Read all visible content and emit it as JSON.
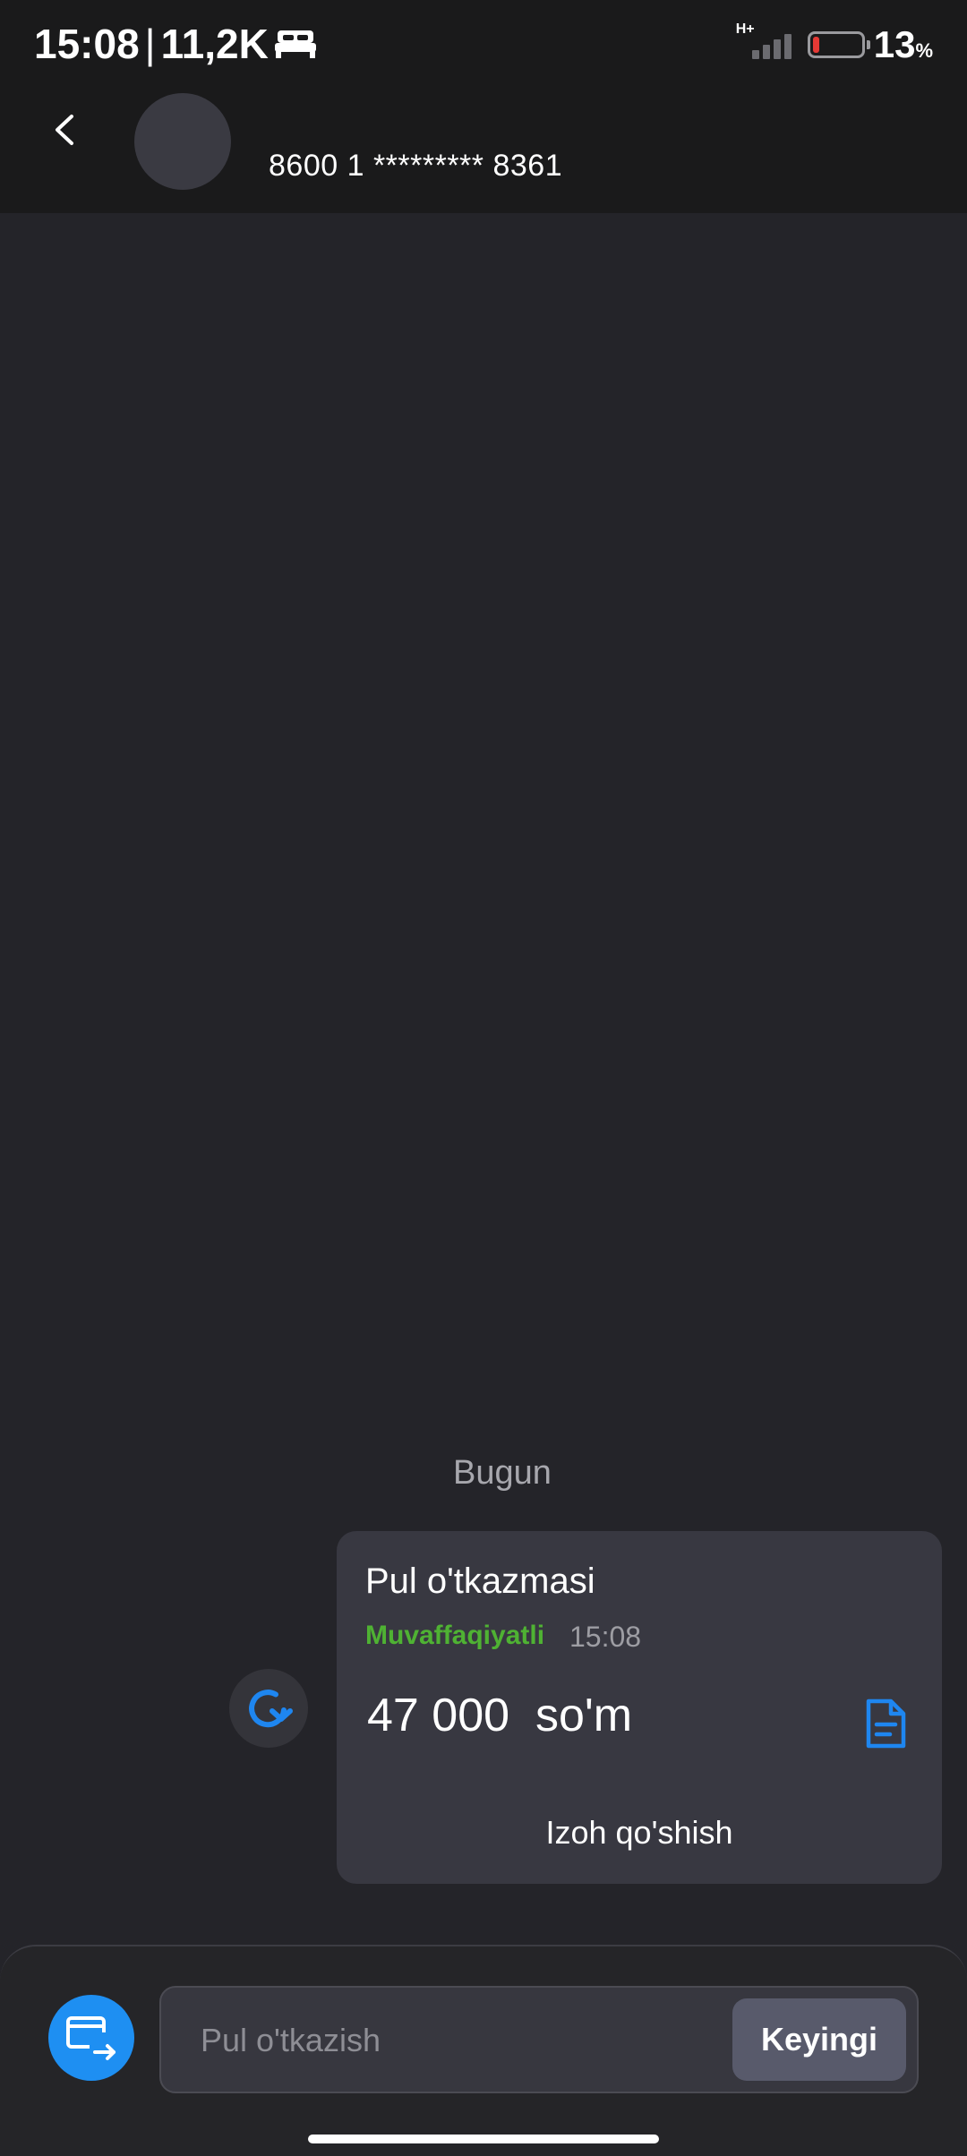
{
  "status_bar": {
    "time": "15:08",
    "separator": "|",
    "network_speed": "11,2K",
    "network_type": "H+",
    "battery_percent": "13",
    "battery_unit": "%",
    "battery_level": 0.13,
    "battery_color": "#e53935"
  },
  "header": {
    "back_icon": "chevron-left-icon",
    "contact_number": "8600 1 ********* 8361"
  },
  "chat": {
    "date_label": "Bugun",
    "repeat_icon": "repeat-icon",
    "transfer_card": {
      "title": "Pul o'tkazmasi",
      "status": "Muvaffaqiyatli",
      "status_color": "#4fb233",
      "time": "15:08",
      "amount": "47 000  so'm",
      "receipt_icon": "document-icon",
      "comment_label": "Izoh qo'shish"
    }
  },
  "bottom_bar": {
    "transfer_icon": "card-transfer-icon",
    "accent_color": "#1e8ff2",
    "input_placeholder": "Pul o'tkazish",
    "input_value": "",
    "next_label": "Keyingi"
  }
}
